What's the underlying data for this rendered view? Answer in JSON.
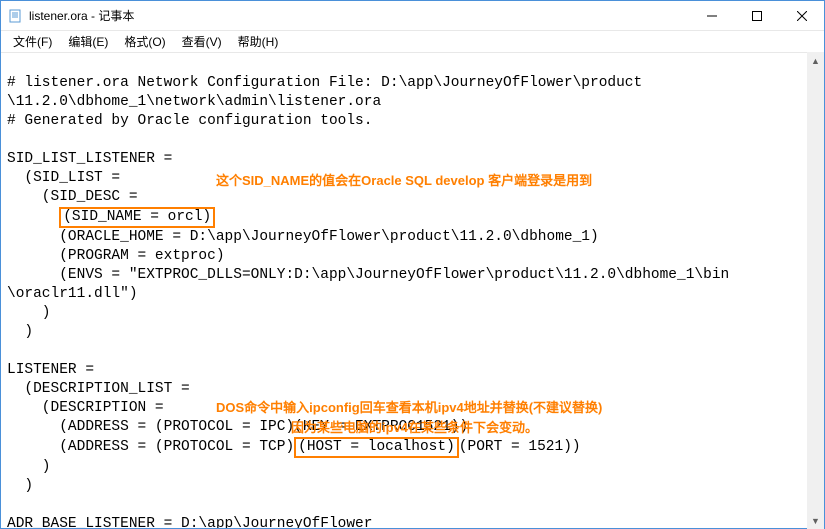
{
  "window": {
    "title": "listener.ora - 记事本",
    "icon_name": "notepad-icon"
  },
  "menu": {
    "file": "文件(F)",
    "edit": "编辑(E)",
    "format": "格式(O)",
    "view": "查看(V)",
    "help": "帮助(H)"
  },
  "content": {
    "l1": "# listener.ora Network Configuration File: D:\\app\\JourneyOfFlower\\product",
    "l2": "\\11.2.0\\dbhome_1\\network\\admin\\listener.ora",
    "l3": "# Generated by Oracle configuration tools.",
    "l4": "",
    "l5": "SID_LIST_LISTENER =",
    "l6": "  (SID_LIST =",
    "l7": "    (SID_DESC =",
    "l8a": "      ",
    "l8b_hl": "(SID_NAME = orcl)",
    "l9": "      (ORACLE_HOME = D:\\app\\JourneyOfFlower\\product\\11.2.0\\dbhome_1)",
    "l10": "      (PROGRAM = extproc)",
    "l11": "      (ENVS = \"EXTPROC_DLLS=ONLY:D:\\app\\JourneyOfFlower\\product\\11.2.0\\dbhome_1\\bin",
    "l12": "\\oraclr11.dll\")",
    "l13": "    )",
    "l14": "  )",
    "l15": "",
    "l16": "LISTENER =",
    "l17": "  (DESCRIPTION_LIST =",
    "l18": "    (DESCRIPTION =",
    "l19": "      (ADDRESS = (PROTOCOL = IPC)(KEY = EXTPROC1521))",
    "l20a": "      (ADDRESS = (PROTOCOL = TCP)",
    "l20b_hl": "(HOST = localhost)",
    "l20c": "(PORT = 1521))",
    "l21": "    )",
    "l22": "  )",
    "l23": "",
    "l24": "ADR_BASE_LISTENER = D:\\app\\JourneyOfFlower"
  },
  "annotations": {
    "a1": "这个SID_NAME的值会在Oracle SQL develop 客户端登录是用到",
    "a2": "DOS命令中输入ipconfig回车查看本机ipv4地址并替换(不建议替换)",
    "a3": "因为某些电脑的ipv4在某些条件下会变动。"
  }
}
